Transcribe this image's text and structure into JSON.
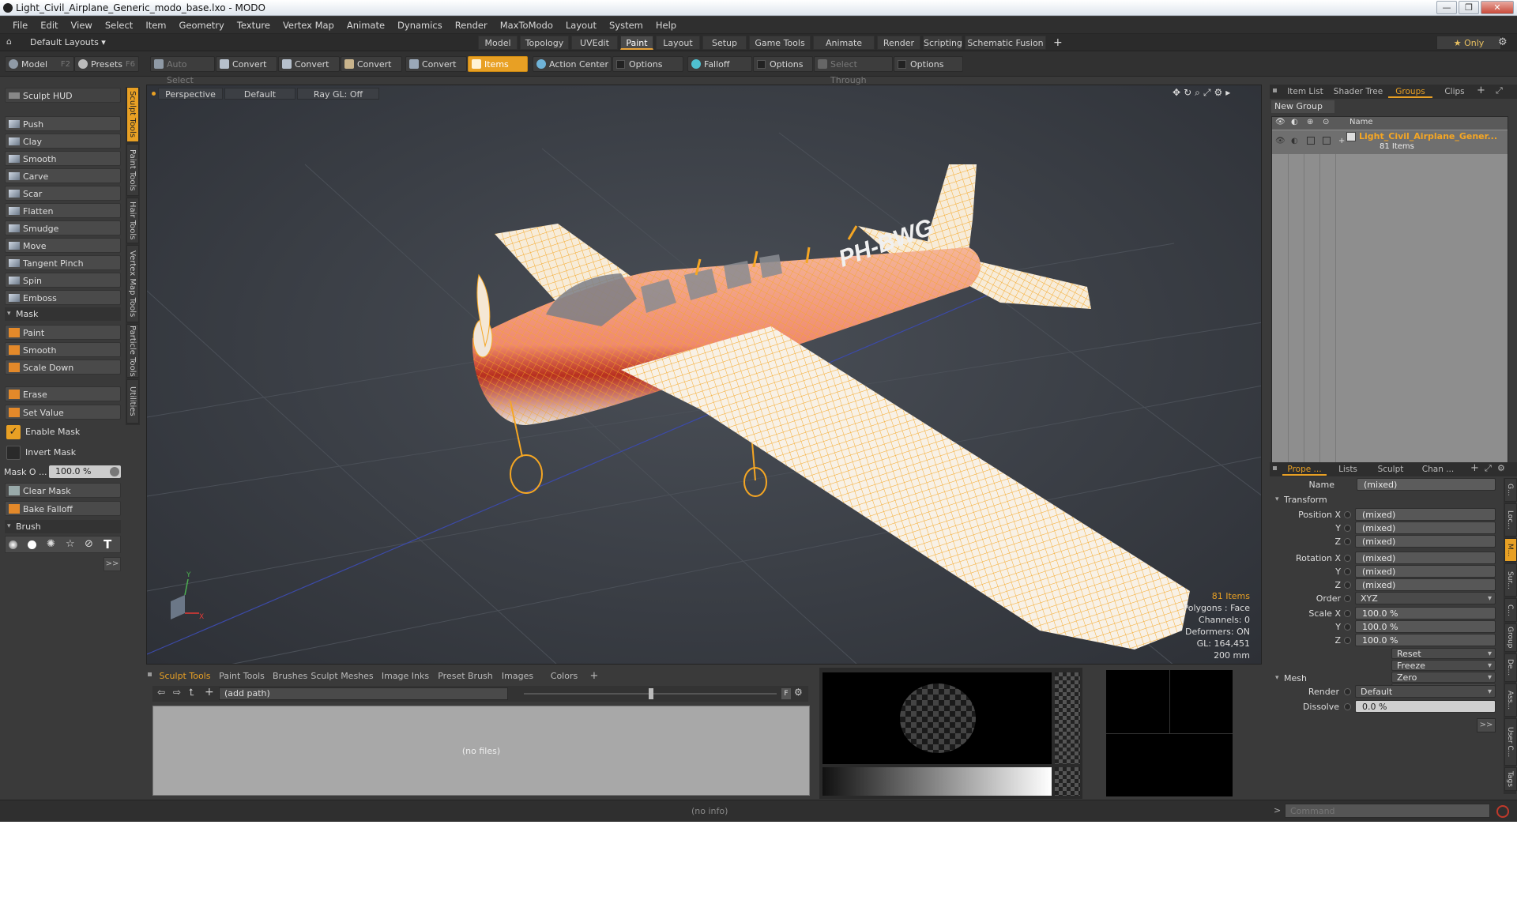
{
  "window": {
    "title": "Light_Civil_Airplane_Generic_modo_base.lxo - MODO",
    "minimize": "—",
    "maximize": "❐",
    "close": "✕"
  },
  "menu": [
    "File",
    "Edit",
    "View",
    "Select",
    "Item",
    "Geometry",
    "Texture",
    "Vertex Map",
    "Animate",
    "Dynamics",
    "Render",
    "MaxToModo",
    "Layout",
    "System",
    "Help"
  ],
  "layoutbar": {
    "layouts_label": "Default Layouts ▾",
    "tabs": [
      "Model",
      "Topology",
      "UVEdit",
      "Paint",
      "Layout",
      "Setup",
      "Game Tools",
      "Animate",
      "Render",
      "Scripting",
      "Schematic Fusion"
    ],
    "active": "Paint",
    "add": "+",
    "only": "★  Only",
    "gear": "⚙"
  },
  "toolbar": {
    "model": "Model",
    "model_key": "F2",
    "presets": "Presets",
    "presets_key": "F6",
    "auto_select": "Auto Select",
    "convert1": "Convert",
    "convert2": "Convert",
    "convert3": "Convert",
    "convert4": "Convert",
    "items": "Items",
    "action_center": "Action Center",
    "options1": "Options",
    "falloff": "Falloff",
    "options2": "Options",
    "select_through": "Select Through",
    "options3": "Options"
  },
  "leftpanel": {
    "hud": "Sculpt HUD",
    "tools": [
      "Push",
      "Clay",
      "Smooth",
      "Carve",
      "Scar",
      "Flatten",
      "Smudge",
      "Move",
      "Tangent Pinch",
      "Spin",
      "Emboss"
    ],
    "mask_section": "Mask",
    "mask_tools": [
      "Paint",
      "Smooth",
      "Scale Down"
    ],
    "erase": "Erase",
    "set_value": "Set Value",
    "enable_mask": "Enable Mask",
    "invert_mask": "Invert Mask",
    "mask_opacity_label": "Mask O ...",
    "mask_opacity_value": "100.0 %",
    "clear_mask": "Clear Mask",
    "bake_falloff": "Bake Falloff",
    "brush_section": "Brush",
    "more": ">>"
  },
  "vtabs": [
    "Sculpt Tools",
    "Paint Tools",
    "Hair Tools",
    "Vertex Map Tools",
    "Particle Tools",
    "Utilities"
  ],
  "viewport": {
    "perspective": "Perspective",
    "default": "Default",
    "raygl": "Ray GL: Off",
    "registration": "PH-BWG",
    "stats": [
      "81 Items",
      "Polygons : Face",
      "Channels: 0",
      "Deformers: ON",
      "GL: 164,451",
      "200 mm"
    ],
    "axis_y": "Y",
    "axis_x": "X"
  },
  "bottom": {
    "tabs": [
      "Sculpt Tools",
      "Paint Tools",
      "Brushes",
      "Sculpt Meshes",
      "Image Inks",
      "Preset Brush",
      "Images",
      "Colors"
    ],
    "add": "+",
    "path": "(add path)",
    "nofiles": "(no files)",
    "f": "F"
  },
  "status": {
    "info": "(no info)",
    "command_placeholder": "Command",
    "prompt": ">"
  },
  "rightpanel": {
    "top_tabs": [
      "Item List",
      "Shader Tree",
      "Groups",
      "Clips"
    ],
    "top_active": "Groups",
    "new_group": "New Group",
    "name_header": "Name",
    "group_name": "Light_Civil_Airplane_Gener...",
    "group_count": "81 Items",
    "prop_tabs": [
      "Prope ...",
      "Lists",
      "Sculpt",
      "Chan ..."
    ],
    "prop_active": "Prope ...",
    "name_label": "Name",
    "name_value": "(mixed)",
    "transform": "Transform",
    "position_x": "Position X",
    "rotation_x": "Rotation X",
    "order": "Order",
    "scale_x": "Scale X",
    "y": "Y",
    "z": "Z",
    "mixed": "(mixed)",
    "order_value": "XYZ",
    "scale_value": "100.0 %",
    "reset": "Reset",
    "freeze": "Freeze",
    "zero": "Zero",
    "add": "Add",
    "mesh": "Mesh",
    "render_label": "Render",
    "render_value": "Default",
    "dissolve_label": "Dissolve",
    "dissolve_value": "0.0 %",
    "more": ">>",
    "side_tabs": [
      "G...",
      "Loc...",
      "M...",
      "Sur...",
      "C...",
      "Group",
      "De...",
      "Ass...",
      "User C...",
      "Tags"
    ]
  },
  "colors": {
    "accent": "#e8a024",
    "wire": "#f5a623",
    "body_red": "#b83020"
  }
}
